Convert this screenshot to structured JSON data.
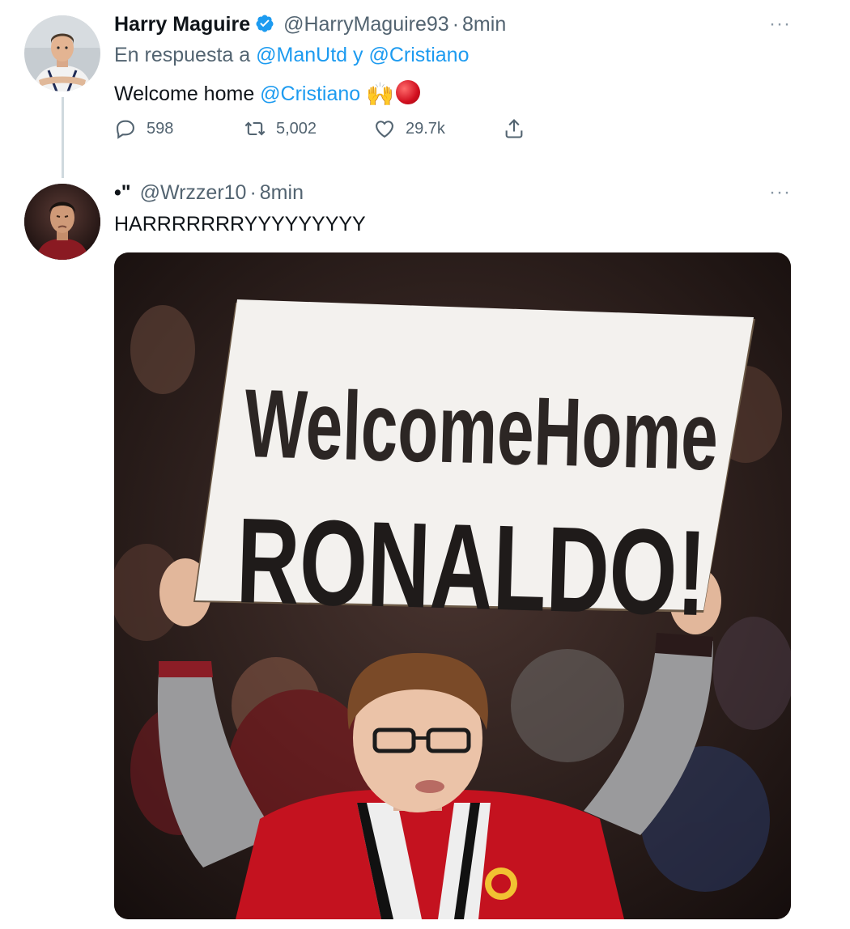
{
  "tweet1": {
    "name": "Harry Maguire",
    "handle": "@HarryMaguire93",
    "separator": "·",
    "time": "8min",
    "reply_prefix": "En respuesta a",
    "reply_user1": "@ManUtd",
    "reply_conj": "y",
    "reply_user2": "@Cristiano",
    "text": "Welcome home",
    "mention": "@Cristiano",
    "emoji_hands": "🙌",
    "stats": {
      "replies": "598",
      "retweets": "5,002",
      "likes": "29.7k"
    }
  },
  "tweet2": {
    "name": "•\"",
    "handle": "@Wrzzer10",
    "separator": "·",
    "time": "8min",
    "text": "HARRRRRRRYYYYYYYYY",
    "image": {
      "sign_line1": "WelcomeHome",
      "sign_line2": "RONALDO!"
    }
  },
  "more_glyph": "···",
  "colors": {
    "link": "#1d9bf0",
    "muted": "#536471",
    "verified": "#1d9bf0"
  }
}
